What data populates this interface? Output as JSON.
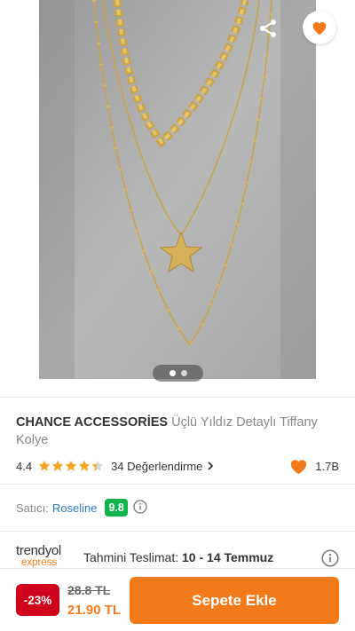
{
  "gallery": {
    "current": 1,
    "total": 2
  },
  "product": {
    "brand": "CHANCE ACCESSORİES",
    "name": "Üçlü Yıldız Detaylı Tiffany Kolye"
  },
  "rating": {
    "score": "4.4",
    "stars_value": 4.4,
    "reviews_label": "34 Değerlendirme",
    "favorites": "1.7B"
  },
  "seller": {
    "label": "Satıcı:",
    "name": "Roseline",
    "score": "9.8"
  },
  "delivery": {
    "logo_top": "trendyol",
    "logo_bottom": "express",
    "label": "Tahmini Teslimat:",
    "range": "10 - 14 Temmuz"
  },
  "price": {
    "discount": "-23%",
    "old": "28.8 TL",
    "new": "21.90 TL"
  },
  "cart": {
    "label": "Sepete Ekle"
  },
  "colors": {
    "accent": "#f27a1a",
    "discount_bg": "#d0021b",
    "seller_score_bg": "#10b44b",
    "link": "#2b7bc0",
    "star": "#f5a623"
  },
  "icons": [
    "back-arrow-icon",
    "share-icon",
    "heart-icon",
    "star-icon",
    "chevron-right-icon",
    "info-icon"
  ]
}
